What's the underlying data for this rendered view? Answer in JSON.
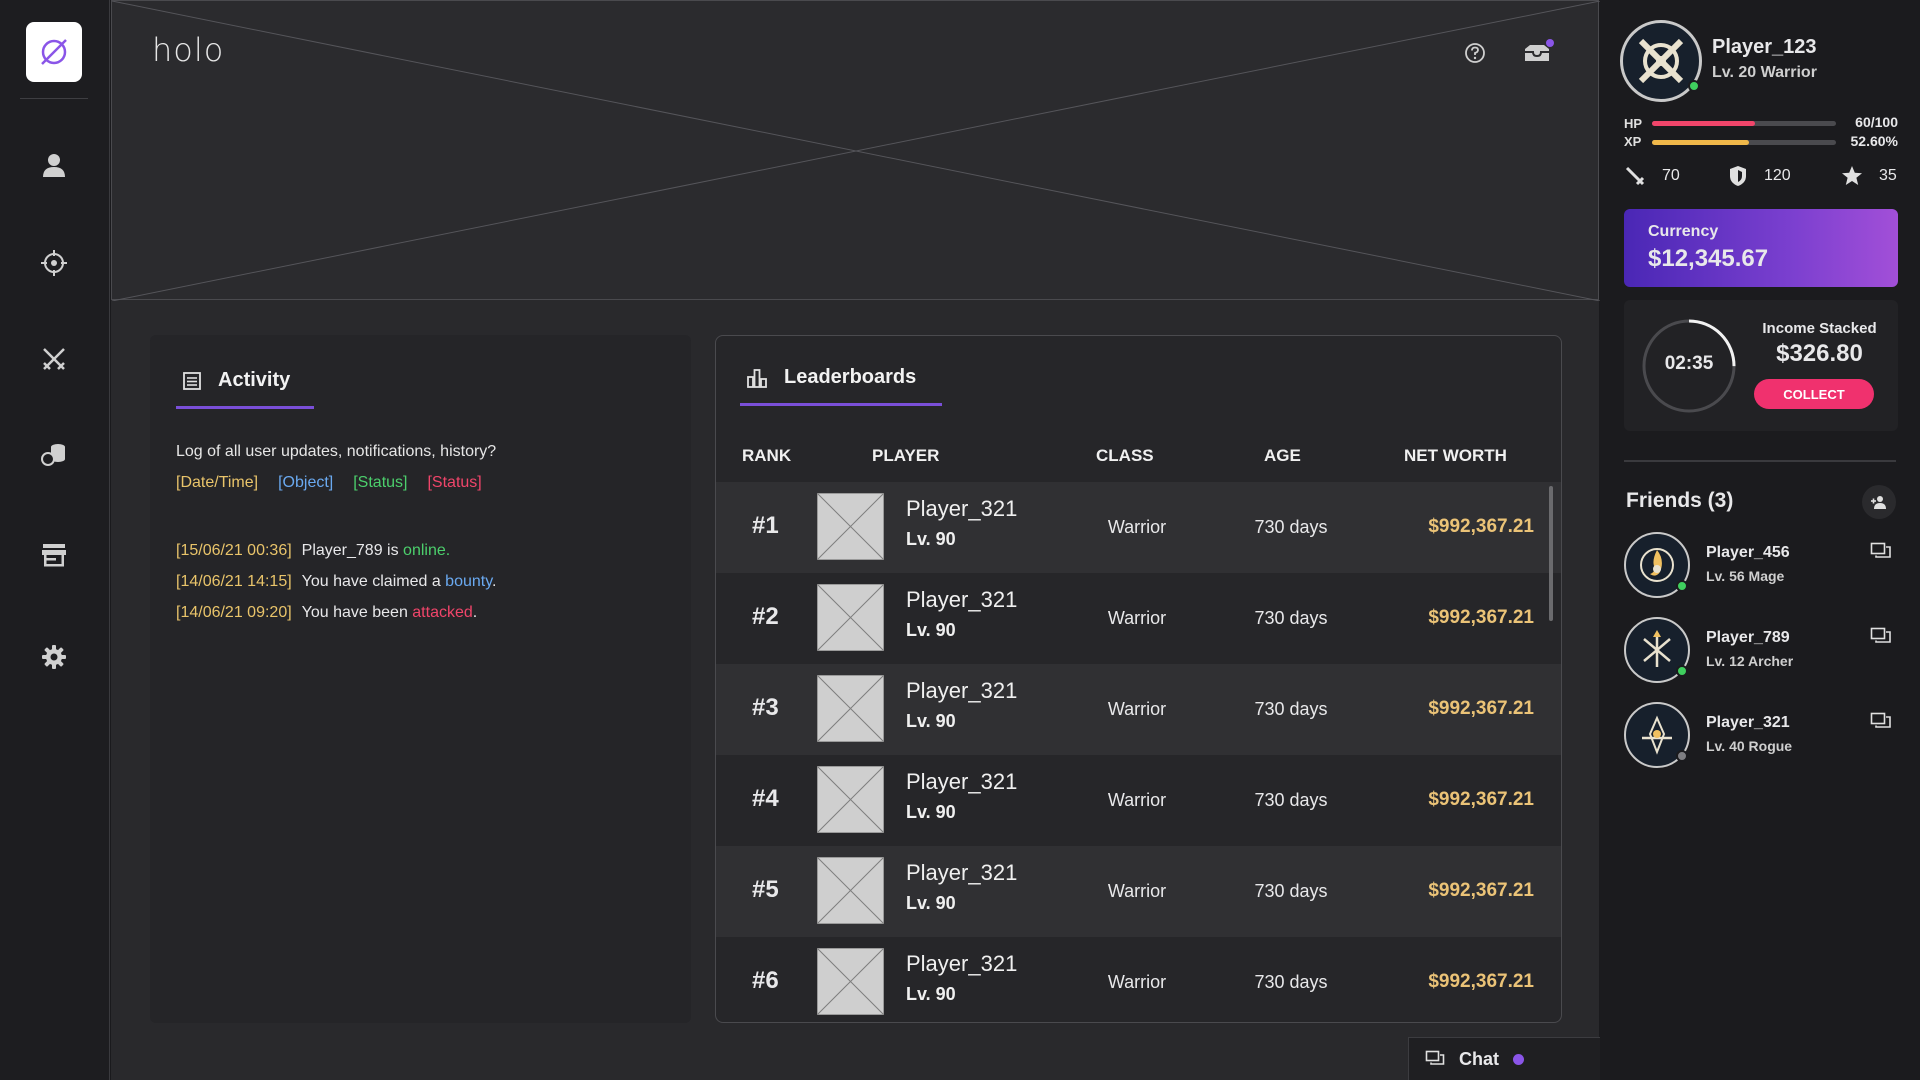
{
  "app": {
    "brand": "holo"
  },
  "nav": {
    "items": [
      {
        "name": "profile",
        "icon": "user-icon"
      },
      {
        "name": "target",
        "icon": "crosshair-icon"
      },
      {
        "name": "battle",
        "icon": "crossed-swords-icon"
      },
      {
        "name": "economy",
        "icon": "coins-icon"
      },
      {
        "name": "store",
        "icon": "storefront-icon"
      },
      {
        "name": "settings",
        "icon": "gear-icon"
      }
    ]
  },
  "activity": {
    "tab_label": "Activity",
    "description": "Log of all user updates, notifications, history?",
    "legend": {
      "date": "[Date/Time]",
      "object": "[Object]",
      "status_ok": "[Status]",
      "status_bad": "[Status]"
    },
    "log": [
      {
        "date": "[15/06/21 00:36]",
        "pre": "Player_789 is ",
        "obj": "",
        "status": "online.",
        "status_kind": "ok",
        "post": ""
      },
      {
        "date": "[14/06/21 14:15]",
        "pre": "You have claimed a ",
        "obj": "bounty",
        "status": "",
        "status_kind": "",
        "post": "."
      },
      {
        "date": "[14/06/21 09:20]",
        "pre": "You have been ",
        "obj": "",
        "status": "attacked",
        "status_kind": "bad",
        "post": "."
      }
    ]
  },
  "leaderboard": {
    "tab_label": "Leaderboards",
    "columns": {
      "rank": "RANK",
      "player": "PLAYER",
      "class": "CLASS",
      "age": "AGE",
      "net_worth": "NET WORTH"
    },
    "rows": [
      {
        "rank": "#1",
        "name": "Player_321",
        "level": "Lv. 90",
        "class": "Warrior",
        "age": "730 days",
        "net_worth": "$992,367.21"
      },
      {
        "rank": "#2",
        "name": "Player_321",
        "level": "Lv. 90",
        "class": "Warrior",
        "age": "730 days",
        "net_worth": "$992,367.21"
      },
      {
        "rank": "#3",
        "name": "Player_321",
        "level": "Lv. 90",
        "class": "Warrior",
        "age": "730 days",
        "net_worth": "$992,367.21"
      },
      {
        "rank": "#4",
        "name": "Player_321",
        "level": "Lv. 90",
        "class": "Warrior",
        "age": "730 days",
        "net_worth": "$992,367.21"
      },
      {
        "rank": "#5",
        "name": "Player_321",
        "level": "Lv. 90",
        "class": "Warrior",
        "age": "730 days",
        "net_worth": "$992,367.21"
      },
      {
        "rank": "#6",
        "name": "Player_321",
        "level": "Lv. 90",
        "class": "Warrior",
        "age": "730 days",
        "net_worth": "$992,367.21"
      }
    ]
  },
  "chat": {
    "label": "Chat"
  },
  "profile": {
    "name": "Player_123",
    "subtitle": "Lv. 20 Warrior",
    "hp": {
      "label": "HP",
      "value": "60/100",
      "fraction": 0.56
    },
    "xp": {
      "label": "XP",
      "value": "52.60%",
      "fraction": 0.526
    },
    "attack": "70",
    "defense": "120",
    "stars": "35"
  },
  "currency": {
    "label": "Currency",
    "value": "$12,345.67"
  },
  "income": {
    "timer": "02:35",
    "label": "Income Stacked",
    "value": "$326.80",
    "collect_label": "COLLECT",
    "timer_fraction": 0.25
  },
  "friends": {
    "title": "Friends (3)",
    "list": [
      {
        "name": "Player_456",
        "subtitle": "Lv. 56 Mage",
        "online": true
      },
      {
        "name": "Player_789",
        "subtitle": "Lv. 12 Archer",
        "online": true
      },
      {
        "name": "Player_321",
        "subtitle": "Lv. 40 Rogue",
        "online": false
      }
    ]
  },
  "colors": {
    "accent": "#7a4fd8",
    "gold": "#ebc377",
    "hp": "#f0456a",
    "xp": "#f0b84a",
    "collect": "#f0316e",
    "online": "#3fcf5e"
  }
}
